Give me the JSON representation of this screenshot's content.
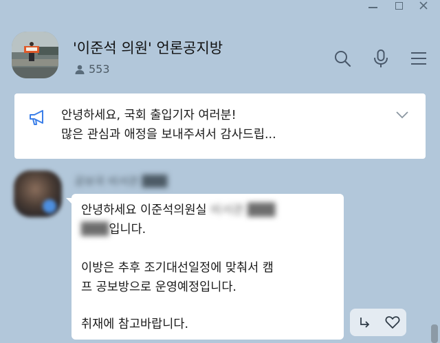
{
  "room": {
    "title": "'이준석 의원' 언론공지방",
    "member_count": "553"
  },
  "notice": {
    "line1": "안녕하세요, 국회 출입기자 여러분!",
    "line2": "많은 관심과 애정을 보내주셔서 감사드립..."
  },
  "message": {
    "sender_name_redacted": "공보국 비서관 ███",
    "line1_prefix": "안녕하세요 이준석의원실 ",
    "line1_redacted": "비서관 ███ ",
    "line2_redacted": "███",
    "line2_suffix": "입니다.",
    "line3": "이방은 추후 조기대선일정에 맞춰서 캠",
    "line4": "프 공보방으로 운영예정입니다.",
    "line5": "취재에 참고바랍니다."
  },
  "colors": {
    "background": "#b2c7da",
    "accent_blue": "#3a7ee8"
  }
}
